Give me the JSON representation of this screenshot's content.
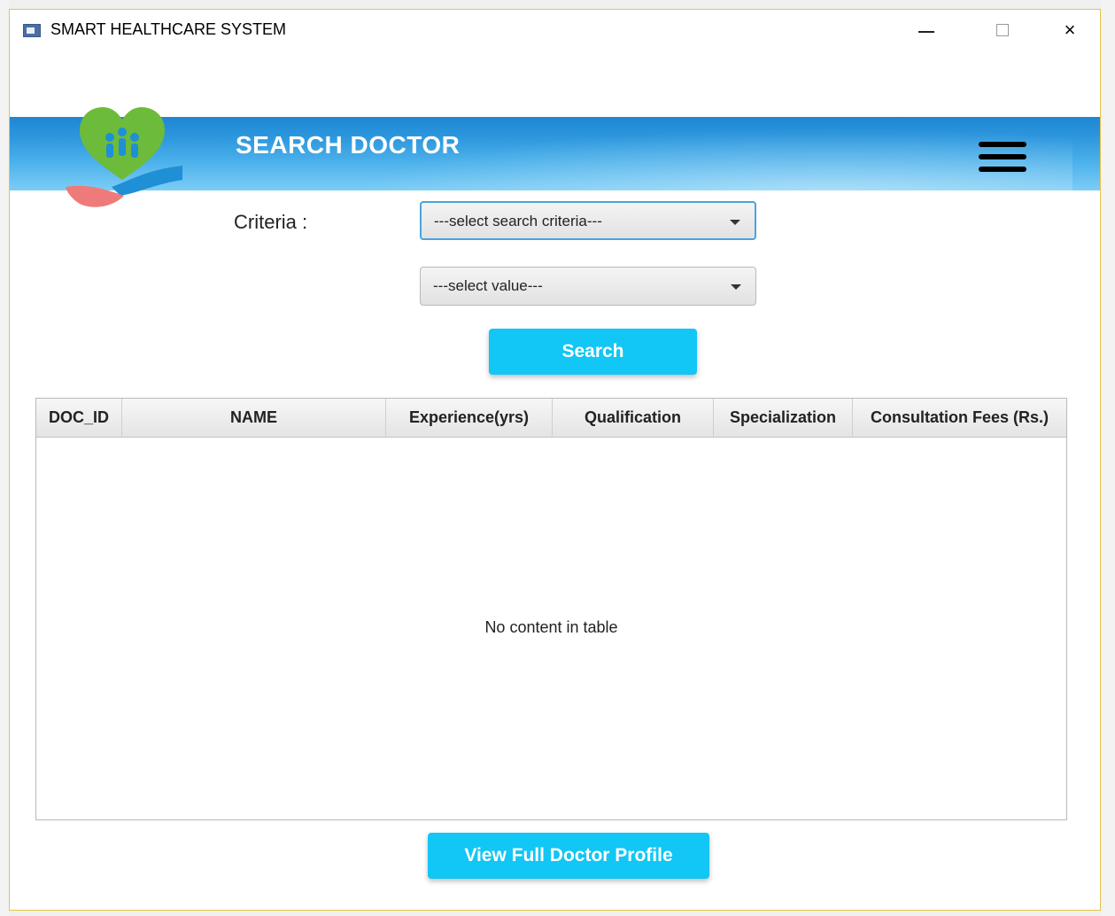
{
  "window": {
    "title": "SMART HEALTHCARE SYSTEM",
    "controls": {
      "minimize": "minimize-icon",
      "maximize": "maximize-icon",
      "close": "×"
    }
  },
  "header": {
    "title": "SEARCH DOCTOR",
    "menu_icon": "hamburger-menu-icon",
    "logo": "heart-hands-logo"
  },
  "form": {
    "criteria_label": "Criteria :",
    "criteria_select": "---select search criteria---",
    "value_select": "---select value---",
    "search_button": "Search"
  },
  "table": {
    "columns": [
      "DOC_ID",
      "NAME",
      "Experience(yrs)",
      "Qualification",
      "Specialization",
      "Consultation Fees (Rs.)"
    ],
    "rows": [],
    "empty_message": "No content in table"
  },
  "footer": {
    "profile_button": "View Full Doctor Profile"
  },
  "colors": {
    "accent_button": "#12c6f5",
    "banner_dark": "#1e86d3",
    "banner_light": "#7ccdf6"
  }
}
